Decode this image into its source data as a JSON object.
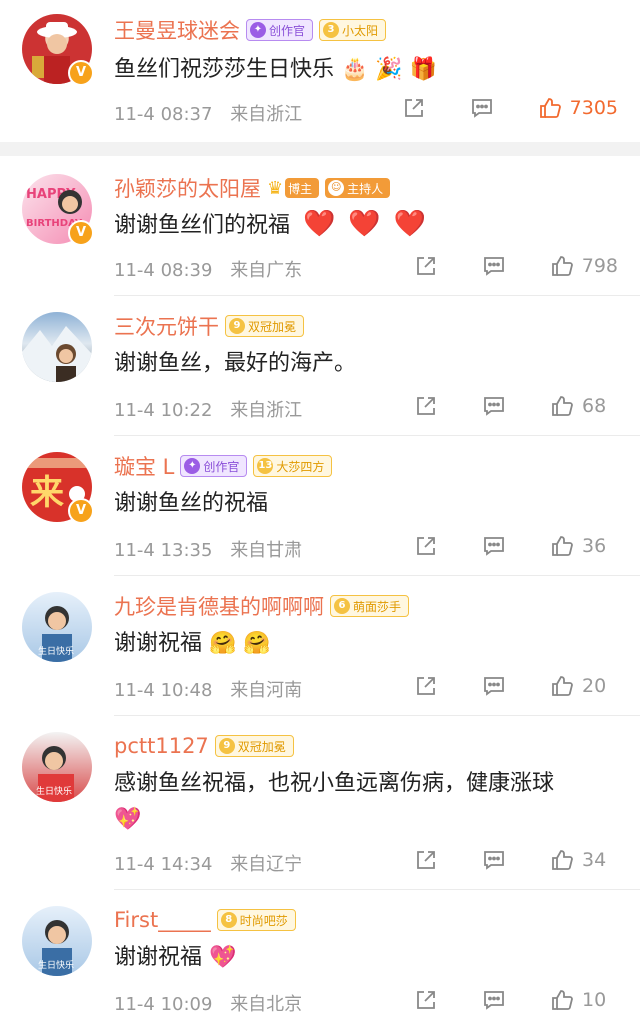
{
  "comments": [
    {
      "name": "王曼昱球迷会",
      "badges": [
        {
          "icon": "✦",
          "label": "创作官"
        },
        {
          "icon": "3",
          "label": "小太阳"
        }
      ],
      "text": "鱼丝们祝莎莎生日快乐",
      "emojis": [
        "🎂",
        "🎉",
        "🎁"
      ],
      "time": "11-4 08:37",
      "location": "来自浙江",
      "likes": "7305",
      "liked": true,
      "avatar_color": "#c33"
    },
    {
      "name": "孙颖莎的太阳屋",
      "badges": [
        {
          "icon": "",
          "label": "博主"
        },
        {
          "icon": "☺",
          "label": "主持人"
        }
      ],
      "text": "谢谢鱼丝们的祝福",
      "emojis": [
        "❤️",
        "❤️",
        "❤️"
      ],
      "time": "11-4 08:39",
      "location": "来自广东",
      "likes": "798",
      "avatar_color": "#e8437a",
      "avatar_text": "HAPPY BIRTHDAY"
    },
    {
      "name": "三次元饼干",
      "badges": [
        {
          "icon": "9",
          "label": "双冠加冕"
        }
      ],
      "text": "谢谢鱼丝，最好的海产。",
      "emojis": [],
      "time": "11-4 10:22",
      "location": "来自浙江",
      "likes": "68",
      "avatar_color": "#5a6c7a"
    },
    {
      "name": "璇宝 L",
      "badges": [
        {
          "icon": "✦",
          "label": "创作官"
        },
        {
          "icon": "13",
          "label": "大莎四方"
        }
      ],
      "text": "谢谢鱼丝的祝福",
      "emojis": [],
      "time": "11-4 13:35",
      "location": "来自甘肃",
      "likes": "36",
      "avatar_color": "#d8322a",
      "avatar_text": "来"
    },
    {
      "name": "九珍是肯德基的啊啊啊",
      "badges": [
        {
          "icon": "6",
          "label": "萌面莎手"
        }
      ],
      "text": "谢谢祝福",
      "emojis": [
        "🤗",
        "🤗"
      ],
      "time": "11-4 10:48",
      "location": "来自河南",
      "likes": "20",
      "avatar_color": "#bcd6ee",
      "avatar_text": "生日快乐"
    },
    {
      "name": "pctt1127",
      "badges": [
        {
          "icon": "9",
          "label": "双冠加冕"
        }
      ],
      "text": "感谢鱼丝祝福，也祝小鱼远离伤病，健康涨球",
      "emojis": [
        "💖"
      ],
      "time": "11-4 14:34",
      "location": "来自辽宁",
      "likes": "34",
      "avatar_color": "#d84a4a",
      "avatar_text": "生日快乐"
    },
    {
      "name": "First_____",
      "badges": [
        {
          "icon": "8",
          "label": "时尚吧莎"
        }
      ],
      "text": "谢谢祝福",
      "emojis": [
        "💖"
      ],
      "time": "11-4 10:09",
      "location": "来自北京",
      "likes": "10",
      "avatar_color": "#bcd6ee",
      "avatar_text": "生日快乐"
    }
  ],
  "colors": {
    "name": "#eb7350",
    "like_active": "#f26a2f",
    "meta": "#999999"
  },
  "icons": {
    "share": "share-icon",
    "comment": "comment-icon",
    "like": "thumbs-up-icon",
    "verified": "verified-v-icon"
  }
}
